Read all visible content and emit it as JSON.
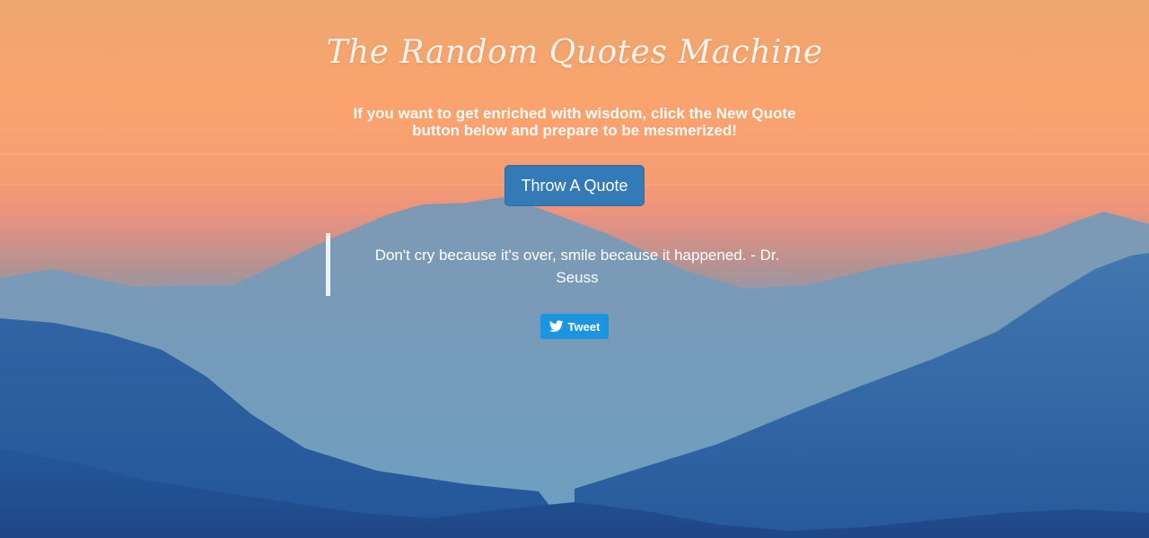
{
  "page": {
    "title": "The Random Quotes Machine",
    "subtitle": "If you want to get enriched with wisdom, click the New Quote button below and prepare to be mesmerized!"
  },
  "actions": {
    "new_quote_label": "Throw A Quote",
    "tweet_label": "Tweet"
  },
  "quote": {
    "text": "Don't cry because it's over, smile because it happened. - Dr. Seuss"
  },
  "icons": {
    "tweet": "twitter-bird-icon"
  },
  "colors": {
    "sky_top": "#f4a86b",
    "sky_mid": "#f39a72",
    "horizon": "#6f9bb8",
    "mountain_deep": "#1a4c93",
    "button_primary": "#337ab7",
    "tweet_button": "#1b95e0"
  }
}
